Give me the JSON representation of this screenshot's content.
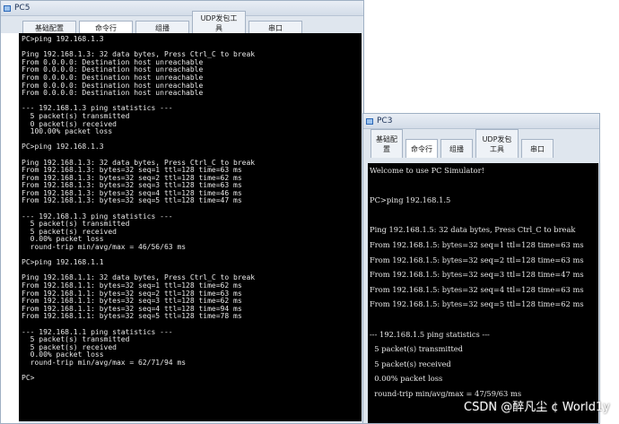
{
  "pc5": {
    "title": "PC5",
    "tabs": [
      "基础配置",
      "命令行",
      "组播",
      "UDP发包工具",
      "串口"
    ],
    "active_tab": 1,
    "lines": [
      "PC>ping 192.168.1.3",
      "",
      "Ping 192.168.1.3: 32 data bytes, Press Ctrl_C to break",
      "From 0.0.0.0: Destination host unreachable",
      "From 0.0.0.0: Destination host unreachable",
      "From 0.0.0.0: Destination host unreachable",
      "From 0.0.0.0: Destination host unreachable",
      "From 0.0.0.0: Destination host unreachable",
      "",
      "--- 192.168.1.3 ping statistics ---",
      "  5 packet(s) transmitted",
      "  0 packet(s) received",
      "  100.00% packet loss",
      "",
      "PC>ping 192.168.1.3",
      "",
      "Ping 192.168.1.3: 32 data bytes, Press Ctrl_C to break",
      "From 192.168.1.3: bytes=32 seq=1 ttl=128 time=63 ms",
      "From 192.168.1.3: bytes=32 seq=2 ttl=128 time=62 ms",
      "From 192.168.1.3: bytes=32 seq=3 ttl=128 time=63 ms",
      "From 192.168.1.3: bytes=32 seq=4 ttl=128 time=46 ms",
      "From 192.168.1.3: bytes=32 seq=5 ttl=128 time=47 ms",
      "",
      "--- 192.168.1.3 ping statistics ---",
      "  5 packet(s) transmitted",
      "  5 packet(s) received",
      "  0.00% packet loss",
      "  round-trip min/avg/max = 46/56/63 ms",
      "",
      "PC>ping 192.168.1.1",
      "",
      "Ping 192.168.1.1: 32 data bytes, Press Ctrl_C to break",
      "From 192.168.1.1: bytes=32 seq=1 ttl=128 time=62 ms",
      "From 192.168.1.1: bytes=32 seq=2 ttl=128 time=63 ms",
      "From 192.168.1.1: bytes=32 seq=3 ttl=128 time=62 ms",
      "From 192.168.1.1: bytes=32 seq=4 ttl=128 time=94 ms",
      "From 192.168.1.1: bytes=32 seq=5 ttl=128 time=78 ms",
      "",
      "--- 192.168.1.1 ping statistics ---",
      "  5 packet(s) transmitted",
      "  5 packet(s) received",
      "  0.00% packet loss",
      "  round-trip min/avg/max = 62/71/94 ms",
      "",
      "PC>"
    ]
  },
  "pc3": {
    "title": "PC3",
    "tabs": [
      "基础配置",
      "命令行",
      "组播",
      "UDP发包工具",
      "串口"
    ],
    "active_tab": 1,
    "lines": [
      "Welcome to use PC Simulator!",
      "",
      "PC>ping 192.168.1.5",
      "",
      "Ping 192.168.1.5: 32 data bytes, Press Ctrl_C to break",
      "From 192.168.1.5: bytes=32 seq=1 ttl=128 time=63 ms",
      "From 192.168.1.5: bytes=32 seq=2 ttl=128 time=63 ms",
      "From 192.168.1.5: bytes=32 seq=3 ttl=128 time=47 ms",
      "From 192.168.1.5: bytes=32 seq=4 ttl=128 time=63 ms",
      "From 192.168.1.5: bytes=32 seq=5 ttl=128 time=62 ms",
      "",
      "--- 192.168.1.5 ping statistics ---",
      "  5 packet(s) transmitted",
      "  5 packet(s) received",
      "  0.00% packet loss",
      "  round-trip min/avg/max = 47/59/63 ms",
      ""
    ]
  },
  "watermark": "CSDN @醉凡尘 ¢ World1y"
}
